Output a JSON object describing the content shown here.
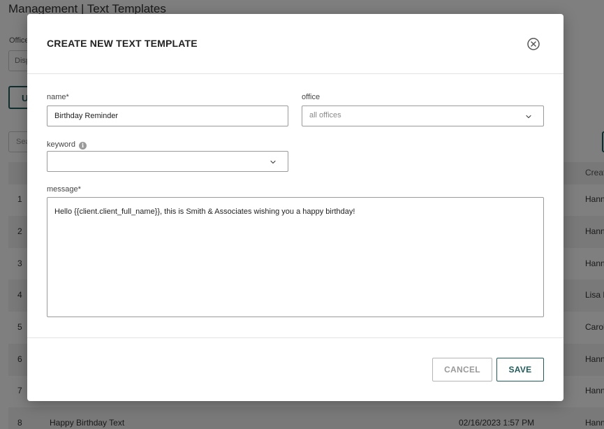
{
  "background": {
    "title": "Management | Text Templates",
    "office_label": "Office",
    "office_select_value": "Disp",
    "action_button_label": "U",
    "search_placeholder": "Sea",
    "table": {
      "creator_header": "Creat",
      "rows": [
        {
          "num": "1",
          "name": "",
          "date": "",
          "creator": "Hann"
        },
        {
          "num": "2",
          "name": "",
          "date": "",
          "creator": "Hann"
        },
        {
          "num": "3",
          "name": "",
          "date": "",
          "creator": "Hann"
        },
        {
          "num": "4",
          "name": "",
          "date": "",
          "creator": "Lisa F"
        },
        {
          "num": "5",
          "name": "",
          "date": "",
          "creator": "Carol"
        },
        {
          "num": "6",
          "name": "",
          "date": "",
          "creator": "Hann"
        },
        {
          "num": "7",
          "name": "",
          "date": "",
          "creator": "Hann"
        },
        {
          "num": "8",
          "name": "Happy Birthday Text",
          "date": "02/16/2023 1:57 PM",
          "creator": "Hann"
        }
      ]
    }
  },
  "modal": {
    "title": "CREATE NEW TEXT TEMPLATE",
    "close_icon": "close-circle-icon",
    "name_field": {
      "label": "name",
      "required_mark": "*",
      "value": "Birthday Reminder"
    },
    "office_field": {
      "label": "office",
      "value": "all offices",
      "icon": "chevron-down-icon"
    },
    "keyword_field": {
      "label": "keyword",
      "info_icon": "info-icon",
      "info_glyph": "i",
      "value": "",
      "icon": "chevron-down-icon"
    },
    "message_field": {
      "label": "message",
      "required_mark": "*",
      "value": "Hello {{client.client_full_name}}, this is Smith & Associates wishing you a happy birthday!"
    },
    "cancel_label": "CANCEL",
    "save_label": "SAVE",
    "colors": {
      "accent": "#1f5c5a",
      "border": "#9a9a9a",
      "overlay": "rgba(0,0,0,0.5)"
    }
  }
}
